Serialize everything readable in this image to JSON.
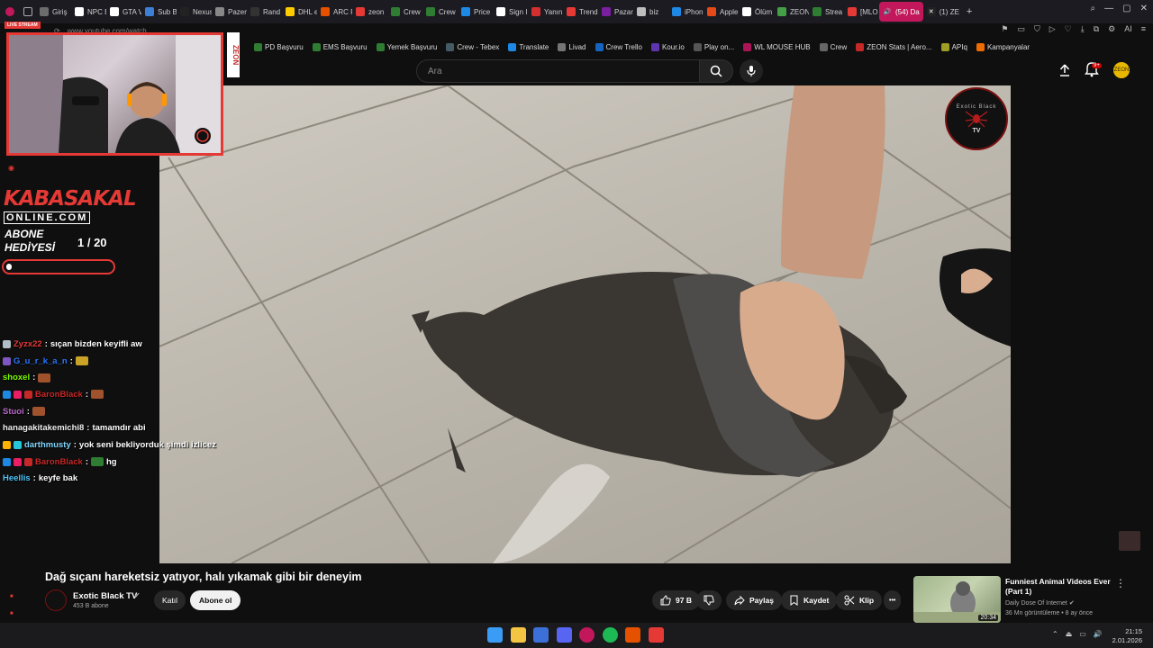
{
  "browser": {
    "tabs": [
      {
        "label": "Giriş",
        "color": "#6c6c6c"
      },
      {
        "label": "NPC B",
        "color": "#ffffff"
      },
      {
        "label": "GTA V",
        "color": "#ffffff"
      },
      {
        "label": "Sub B",
        "color": "#3d7fd6"
      },
      {
        "label": "Nexus",
        "color": "#222222"
      },
      {
        "label": "Pazen",
        "color": "#888888"
      },
      {
        "label": "Rand",
        "color": "#333333"
      },
      {
        "label": "DHL e",
        "color": "#ffcc00"
      },
      {
        "label": "ARC F",
        "color": "#e65100"
      },
      {
        "label": "zeon",
        "color": "#e53935"
      },
      {
        "label": "Crew",
        "color": "#2e7d32"
      },
      {
        "label": "Crew",
        "color": "#2e7d32"
      },
      {
        "label": "Price",
        "color": "#1e88e5"
      },
      {
        "label": "Sign I",
        "color": "#ffffff"
      },
      {
        "label": "Yanın",
        "color": "#d32f2f"
      },
      {
        "label": "Trend",
        "color": "#e53935"
      },
      {
        "label": "Pazar",
        "color": "#7b1fa2"
      },
      {
        "label": "biz",
        "color": "#bdbdbd"
      },
      {
        "label": "iPhon",
        "color": "#1e88e5"
      },
      {
        "label": "Apple",
        "color": "#e64a19"
      },
      {
        "label": "Ölüm",
        "color": "#ffffff"
      },
      {
        "label": "ZEON",
        "color": "#43a047"
      },
      {
        "label": "Strea",
        "color": "#2e7d32"
      },
      {
        "label": "[MLO",
        "color": "#e53935"
      }
    ],
    "active_tab": "(54) Da",
    "last_tab": "(1) ZE",
    "new_tab": "+",
    "url": "www.youtube.com/watch",
    "bookmarks": [
      {
        "label": "PD Başvuru",
        "color": "#2e7d32"
      },
      {
        "label": "EMS Başvuru",
        "color": "#2e7d32"
      },
      {
        "label": "Yemek Başvuru",
        "color": "#2e7d32"
      },
      {
        "label": "Crew - Tebex",
        "color": "#455a64"
      },
      {
        "label": "Translate",
        "color": "#1e88e5"
      },
      {
        "label": "Livad",
        "color": "#757575"
      },
      {
        "label": "Crew Trello",
        "color": "#1565c0"
      },
      {
        "label": "Kour.io",
        "color": "#5e35b1"
      },
      {
        "label": "Play on...",
        "color": "#555555"
      },
      {
        "label": "WL MOUSE HUB",
        "color": "#ad1457"
      },
      {
        "label": "Crew",
        "color": "#666666"
      },
      {
        "label": "ZEON Stats | Aero...",
        "color": "#c62828"
      },
      {
        "label": "APIq",
        "color": "#9e9d24"
      },
      {
        "label": "Kampanyalar",
        "color": "#ef6c00"
      }
    ]
  },
  "youtube": {
    "search_placeholder": "Ara",
    "notification_count": "9+",
    "user_avatar_text": "ZEON",
    "video_title": "Dağ sıçanı hareketsiz yatıyor, halı yıkamak gibi bir deneyim",
    "channel_name": "Exotic Black TV",
    "channel_subs": "453 B abone",
    "channel_logo_top": "Exotic Black",
    "channel_logo_bottom": "TV",
    "join_label": "Katıl",
    "subscribe_label": "Abone ol",
    "likes": "97 B",
    "share_label": "Paylaş",
    "save_label": "Kaydet",
    "clip_label": "Klip",
    "more_label": "•••",
    "recommended": {
      "title": "Funniest Animal Videos Ever (Part 1)",
      "channel": "Daily Dose Of Internet",
      "meta": "36 Mn görüntüleme • 8 ay önce",
      "duration": "20:34"
    }
  },
  "stream_overlay": {
    "live_badge": "LIVE STREAM",
    "side_brand": "ZEON",
    "brand": "KABASAKAL",
    "brand_sub": "ONLINE.COM",
    "gift_label_line1": "ABONE",
    "gift_label_line2": "HEDİYESİ",
    "gift_count": "1 / 20",
    "gift_progress": 0.05,
    "chat": [
      {
        "user": "Zyzx22",
        "user_color": "#e53935",
        "sep": ":",
        "msg": "sıçan bizden keyifli aw",
        "badges": [
          "#b0bec5"
        ],
        "emote": ""
      },
      {
        "user": "G_u_r_k_a_n",
        "user_color": "#2979ff",
        "sep": ":",
        "msg": "",
        "badges": [
          "#7e57c2"
        ],
        "emote": "#c9a227"
      },
      {
        "user": "shoxel",
        "user_color": "#7cfc00",
        "sep": ":",
        "msg": "",
        "badges": [],
        "emote": "#a0522d"
      },
      {
        "user": "BaronBlack",
        "user_color": "#c62828",
        "sep": ":",
        "msg": "",
        "badges": [
          "#1e88e5",
          "#e91e63",
          "#c62828"
        ],
        "emote": "#a0522d"
      },
      {
        "user": "Stuoi",
        "user_color": "#ba68c8",
        "sep": ":",
        "msg": "",
        "badges": [],
        "emote": "#a0522d"
      },
      {
        "user": "hanagakitakemichi8",
        "user_color": "#eeeeee",
        "sep": ":",
        "msg": "tamamdır abi",
        "badges": [],
        "emote": ""
      },
      {
        "user": "darthmusty",
        "user_color": "#81d4fa",
        "sep": ":",
        "msg": "yok seni bekliyorduk şimdi izlicez",
        "badges": [
          "#ffb300",
          "#26c6da"
        ],
        "emote": ""
      },
      {
        "user": "BaronBlack",
        "user_color": "#c62828",
        "sep": ":",
        "msg": "hg",
        "badges": [
          "#1e88e5",
          "#e91e63",
          "#c62828"
        ],
        "emote": "#2e7d32"
      },
      {
        "user": "Heellis",
        "user_color": "#4fc3f7",
        "sep": ":",
        "msg": "keyfe bak",
        "badges": [],
        "emote": ""
      }
    ]
  },
  "taskbar": {
    "time": "21:15",
    "date": "2.01.2026",
    "apps": [
      {
        "name": "start",
        "color": "#3b9cf5"
      },
      {
        "name": "explorer",
        "color": "#f4c542"
      },
      {
        "name": "app-blue",
        "color": "#3d6fd9"
      },
      {
        "name": "discord",
        "color": "#5865f2"
      },
      {
        "name": "opera",
        "color": "#c2185b"
      },
      {
        "name": "spotify",
        "color": "#1db954"
      },
      {
        "name": "app-orange",
        "color": "#e65100"
      },
      {
        "name": "app-red",
        "color": "#e53935"
      }
    ]
  },
  "colors": {
    "accent": "#e53935",
    "youtube_bg": "#0f0f0f"
  }
}
